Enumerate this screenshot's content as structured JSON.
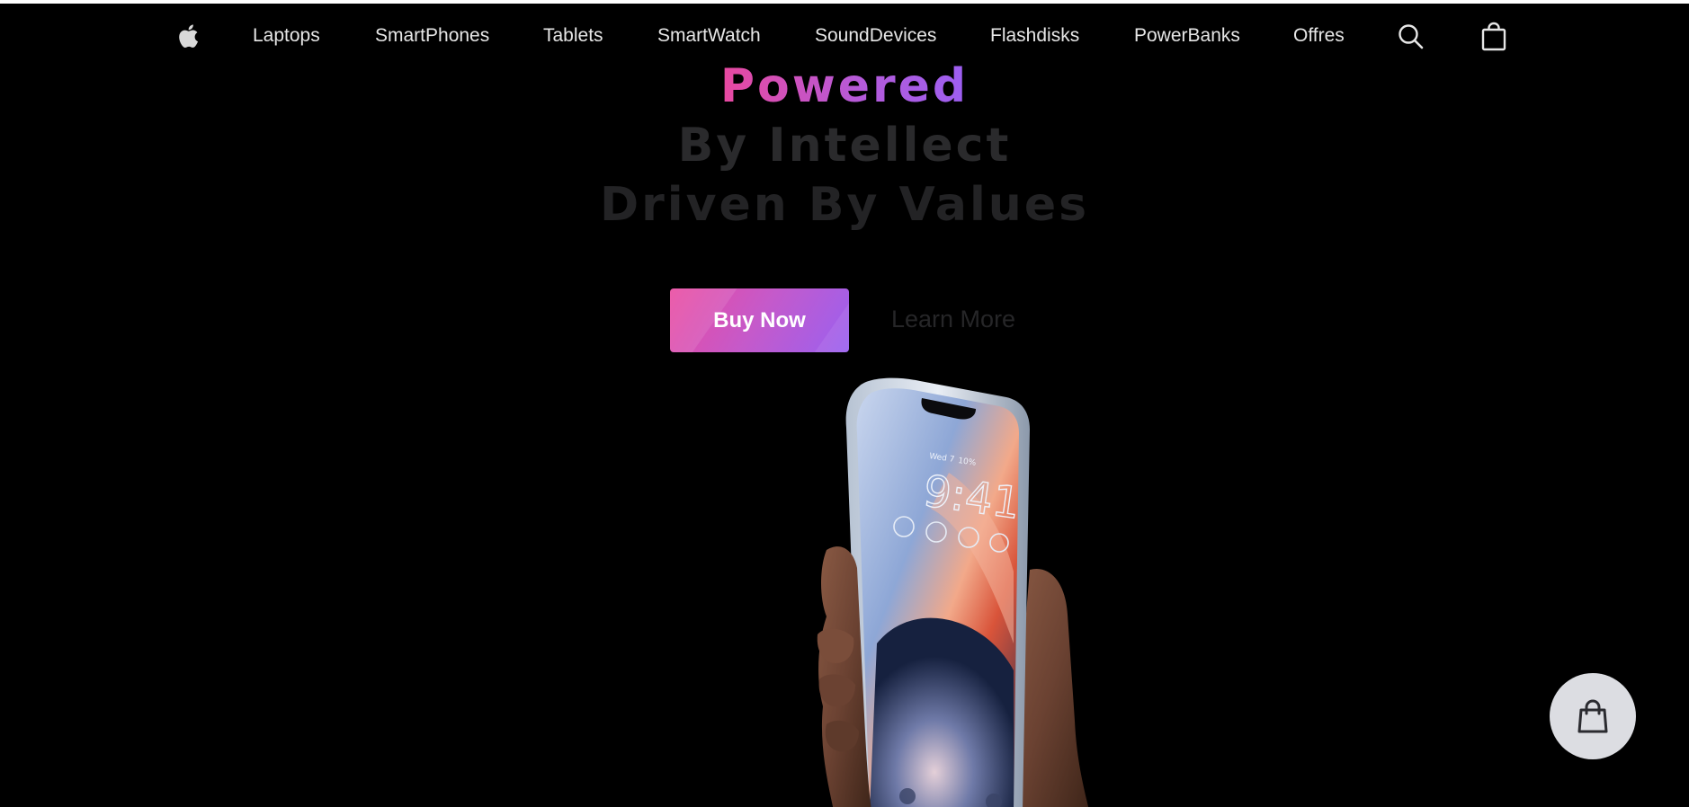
{
  "nav": {
    "logo_icon": "apple-logo-icon",
    "links": [
      "Laptops",
      "SmartPhones",
      "Tablets",
      "SmartWatch",
      "SoundDevices",
      "Flashdisks",
      "PowerBanks",
      "Offres"
    ],
    "search_icon": "search-icon",
    "bag_icon": "shopping-bag-icon"
  },
  "hero": {
    "line1": "Powered",
    "line2": "By Intellect",
    "line3": "Driven By Values",
    "buy_label": "Buy Now",
    "learn_label": "Learn More"
  },
  "phone": {
    "lock_date": "Wed 7",
    "lock_weather": "10%",
    "lock_time": "9:41"
  },
  "floating_cart_icon": "shopping-bag-icon",
  "colors": {
    "background": "#000000",
    "gradient_start": "#ec4899",
    "gradient_end": "#9b5cf0",
    "nav_text": "#e6e6e6",
    "floating_button": "#dcdde2"
  }
}
